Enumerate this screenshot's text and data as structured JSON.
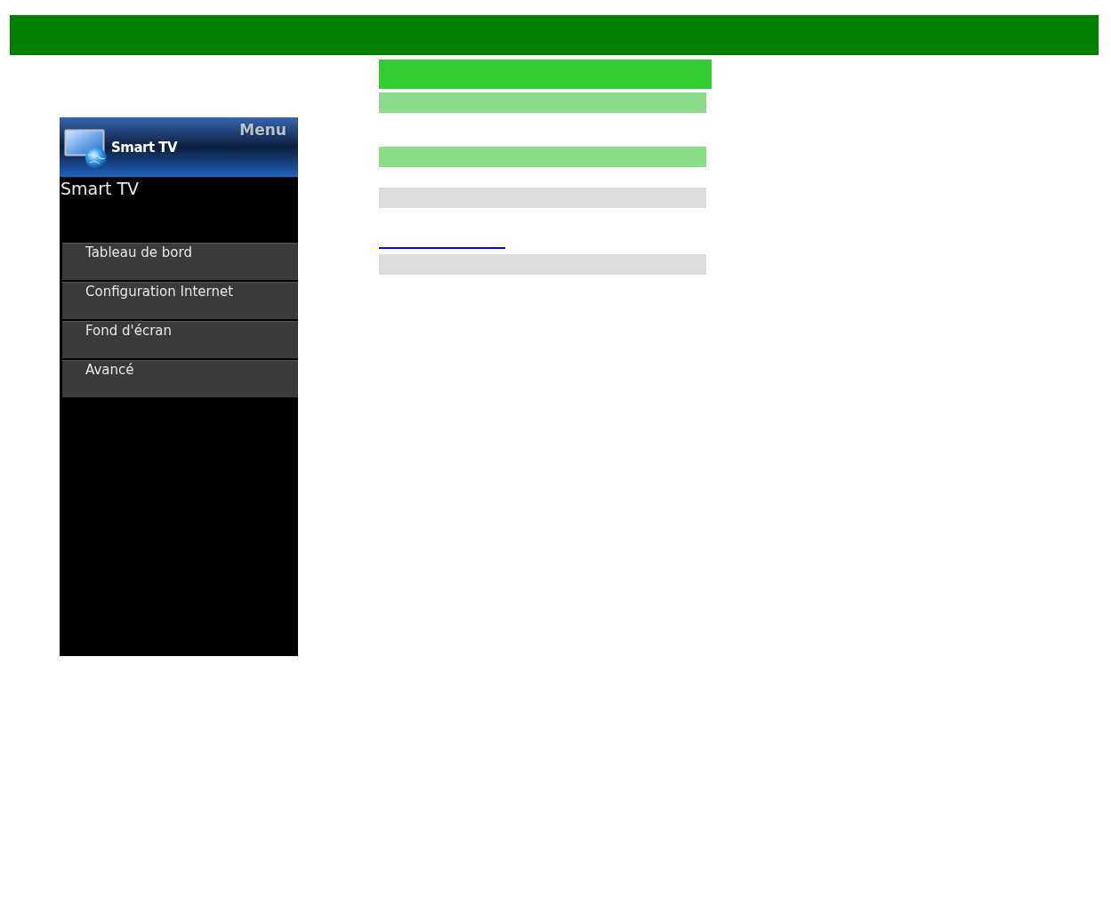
{
  "tv_menu": {
    "menu_label": "Menu",
    "logo_text": "Smart TV",
    "title": "Smart TV",
    "items": [
      {
        "label": "Tableau de bord"
      },
      {
        "label": "Configuration Internet"
      },
      {
        "label": "Fond d'écran"
      },
      {
        "label": "Avancé"
      }
    ]
  },
  "content_blocks": [
    {
      "kind": "heading"
    },
    {
      "kind": "subheading"
    },
    {
      "kind": "subheading"
    },
    {
      "kind": "note"
    },
    {
      "kind": "link"
    },
    {
      "kind": "note"
    }
  ]
}
